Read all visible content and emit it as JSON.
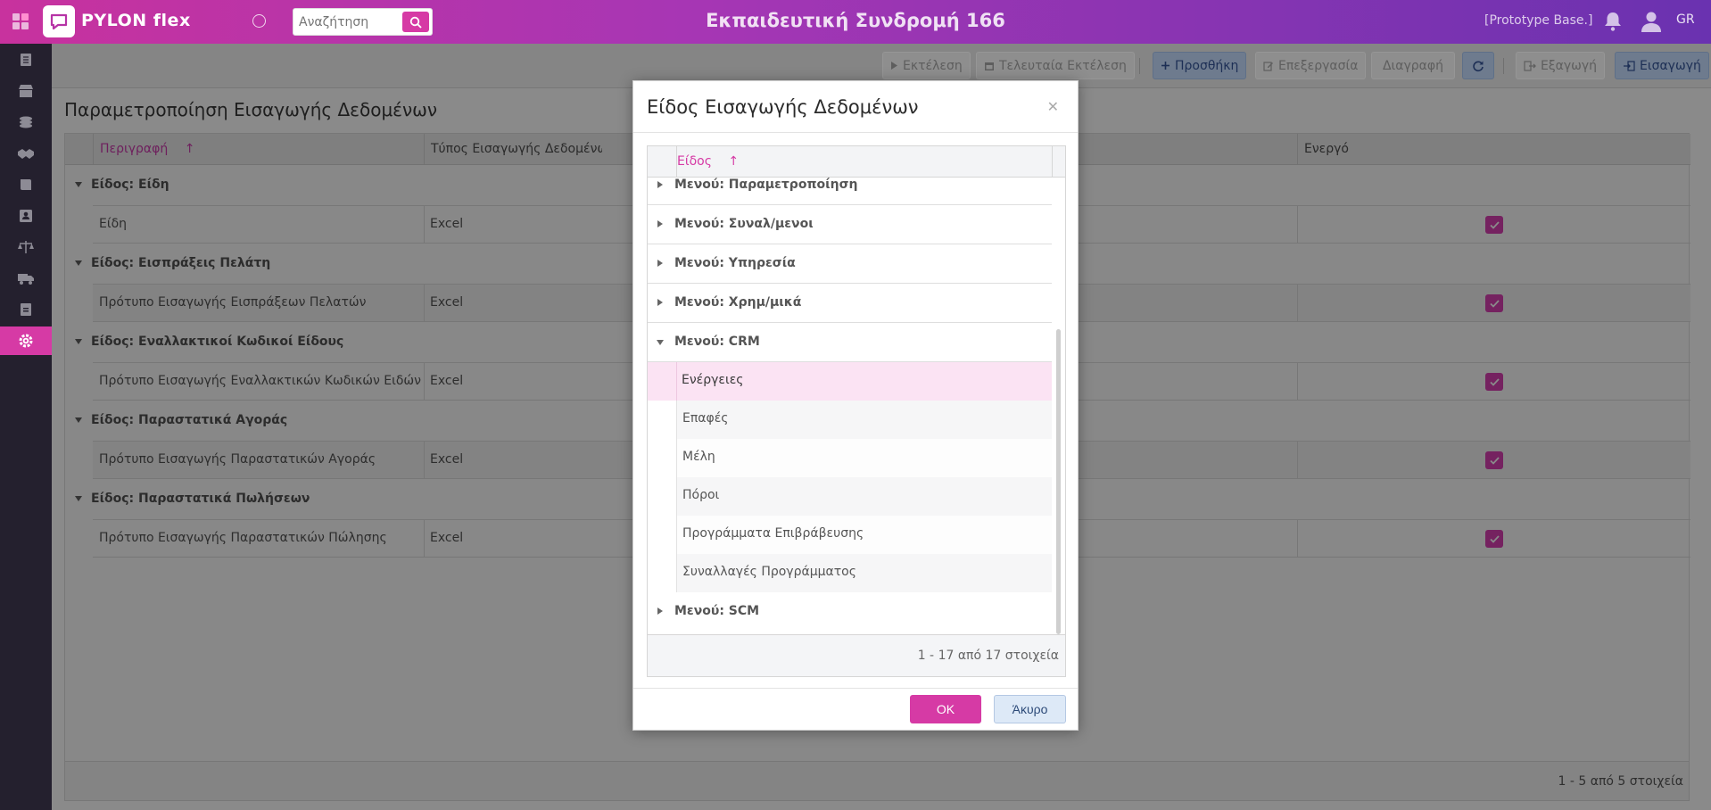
{
  "header": {
    "logo_text": "PYLON flex",
    "search_placeholder": "Αναζήτηση",
    "title": "Εκπαιδευτική Συνδρομή 166",
    "environment": "[Prototype Base.]",
    "language": "GR"
  },
  "toolbar": {
    "run": "Εκτέλεση",
    "last_run": "Τελευταία Εκτέλεση",
    "add": "Προσθήκη",
    "edit": "Επεξεργασία",
    "delete": "Διαγραφή",
    "export": "Εξαγωγή",
    "import": "Εισαγωγή"
  },
  "page": {
    "title": "Παραμετροποίηση Εισαγωγής Δεδομένων",
    "columns": [
      "Περιγραφή",
      "Τύπος Εισαγωγής Δεδομένων",
      "Ενεργό"
    ],
    "groups": [
      {
        "label": "Είδος: Είδη",
        "row": {
          "description": "Είδη",
          "type": "Excel"
        }
      },
      {
        "label": "Είδος: Εισπράξεις Πελάτη",
        "row": {
          "description": "Πρότυπο Εισαγωγής Εισπράξεων Πελατών",
          "type": "Excel"
        }
      },
      {
        "label": "Είδος: Εναλλακτικοί Κωδικοί Είδους",
        "row": {
          "description": "Πρότυπο Εισαγωγής Εναλλακτικών Κωδικών Ειδών",
          "type": "Excel"
        }
      },
      {
        "label": "Είδος: Παραστατικά Αγοράς",
        "row": {
          "description": "Πρότυπο Εισαγωγής Παραστατικών Αγοράς",
          "type": "Excel"
        }
      },
      {
        "label": "Είδος: Παραστατικά Πωλήσεων",
        "row": {
          "description": "Πρότυπο Εισαγωγής Παραστατικών Πώλησης",
          "type": "Excel"
        }
      }
    ],
    "footer": "1 - 5 από 5 στοιχεία"
  },
  "dialog": {
    "title": "Είδος Εισαγωγής Δεδομένων",
    "column": "Είδος",
    "groups": [
      "Μενού: Παραμετροποίηση",
      "Μενού: Συναλ/μενοι",
      "Μενού: Υπηρεσία",
      "Μενού: Χρημ/μικά",
      "Μενού: CRM",
      "Μενού: SCM"
    ],
    "crm_items": [
      "Ενέργειες",
      "Επαφές",
      "Μέλη",
      "Πόροι",
      "Προγράμματα Επιβράβευσης",
      "Συναλλαγές Προγράμματος"
    ],
    "footer": "1 - 17 από 17 στοιχεία",
    "ok": "OK",
    "cancel": "Άκυρο"
  },
  "colors": {
    "accent": "#d63aa5",
    "header_start": "#c8329e",
    "header_end": "#6a32b0",
    "sidebar": "#24202e",
    "selected_row": "#fbe3f3"
  },
  "icons": [
    "apps-grid-icon",
    "chat-logo-icon",
    "status-circle-icon",
    "search-icon",
    "bell-icon",
    "user-icon",
    "play-icon",
    "calendar-icon",
    "plus-icon",
    "edit-icon",
    "refresh-icon",
    "export-icon",
    "import-icon",
    "gear-icon",
    "close-icon"
  ]
}
